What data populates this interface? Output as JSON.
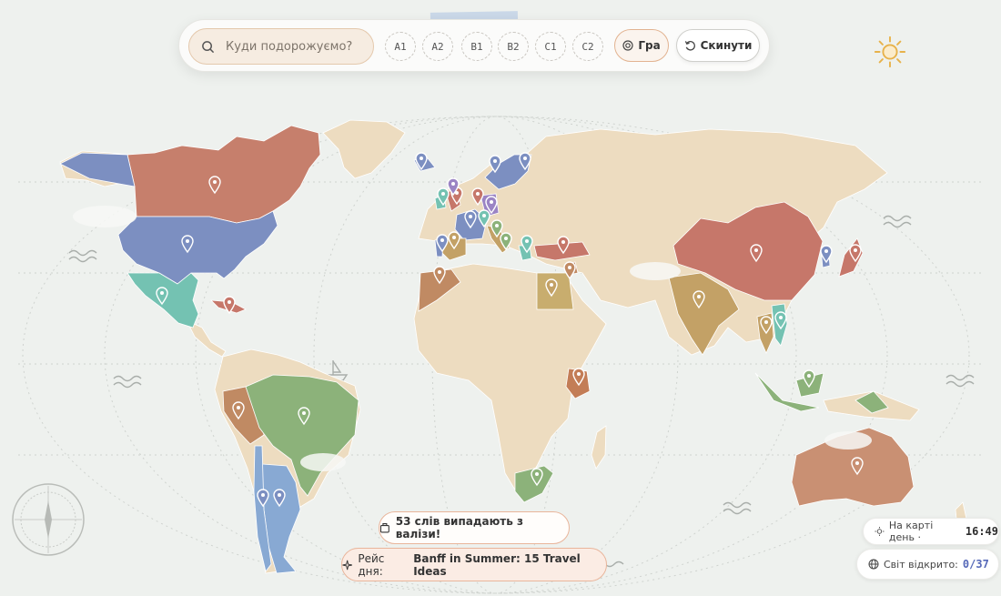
{
  "search": {
    "placeholder": "Куди подорожуємо?"
  },
  "levels": [
    "A1",
    "A2",
    "B1",
    "B2",
    "C1",
    "C2"
  ],
  "buttons": {
    "game": "Гра",
    "reset": "Скинути"
  },
  "toasts": {
    "suitcase": "53 слів випадають з валізи!",
    "flight_prefix": "Рейс дня:",
    "flight_title": "Banff in Summer: 15 Travel Ideas"
  },
  "stats": {
    "time_label": "На карті день ·",
    "time_value": "16:49",
    "discovered_label": "Світ відкрито:",
    "discovered_value": "0/37"
  },
  "colors": {
    "land_default": "#eddcc0",
    "ocean": "#eef1ee",
    "accent": "#e2b391",
    "canada": "#c67f6c",
    "usa": "#7c8fc1",
    "mexico": "#74c2b2",
    "brazil": "#8cb27a",
    "peru": "#c08a63",
    "argentina": "#88a9d3",
    "china": "#c6776a",
    "india": "#c3a166",
    "australia": "#c99073",
    "south_africa": "#8cb27a",
    "indonesia": "#8cb27a",
    "kenya": "#c37d56",
    "egypt": "#c8ad6e"
  },
  "pins": [
    {
      "country": "Canada",
      "color": "#c67f6c"
    },
    {
      "country": "USA",
      "color": "#7c8fc1"
    },
    {
      "country": "Mexico",
      "color": "#74c2b2"
    },
    {
      "country": "Cuba",
      "color": "#c6776a"
    },
    {
      "country": "Peru",
      "color": "#c08a63"
    },
    {
      "country": "Brazil",
      "color": "#8cb27a"
    },
    {
      "country": "Argentina",
      "color": "#7c8fc1"
    },
    {
      "country": "Chile",
      "color": "#7c8fc1"
    },
    {
      "country": "Iceland",
      "color": "#7c8fc1"
    },
    {
      "country": "Norway",
      "color": "#7c8fc1"
    },
    {
      "country": "Sweden",
      "color": "#7c8fc1"
    },
    {
      "country": "Ireland",
      "color": "#74c2b2"
    },
    {
      "country": "UK",
      "color": "#c6776a"
    },
    {
      "country": "Netherlands",
      "color": "#9b84c4"
    },
    {
      "country": "Germany",
      "color": "#9b84c4"
    },
    {
      "country": "France",
      "color": "#7c8fc1"
    },
    {
      "country": "Switzerland",
      "color": "#74c2b2"
    },
    {
      "country": "Italy",
      "color": "#8cb27a"
    },
    {
      "country": "Spain",
      "color": "#c3a166"
    },
    {
      "country": "Portugal",
      "color": "#7c8fc1"
    },
    {
      "country": "Greece",
      "color": "#74c2b2"
    },
    {
      "country": "Turkey",
      "color": "#c6776a"
    },
    {
      "country": "Morocco",
      "color": "#c08a63"
    },
    {
      "country": "Egypt",
      "color": "#c3a166"
    },
    {
      "country": "Jordan",
      "color": "#c08a63"
    },
    {
      "country": "Kenya",
      "color": "#c37d56"
    },
    {
      "country": "South Africa",
      "color": "#8cb27a"
    },
    {
      "country": "India",
      "color": "#c3a166"
    },
    {
      "country": "China",
      "color": "#c6776a"
    },
    {
      "country": "Korea",
      "color": "#7c8fc1"
    },
    {
      "country": "Japan",
      "color": "#c6776a"
    },
    {
      "country": "Thailand",
      "color": "#c3a166"
    },
    {
      "country": "Vietnam",
      "color": "#74c2b2"
    },
    {
      "country": "Indonesia",
      "color": "#8cb27a"
    },
    {
      "country": "Australia",
      "color": "#c99073"
    },
    {
      "country": "Denmark",
      "color": "#c6776a"
    },
    {
      "country": "Croatia",
      "color": "#8cb27a"
    }
  ]
}
